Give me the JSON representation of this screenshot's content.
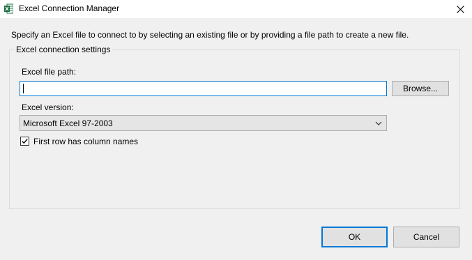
{
  "window": {
    "title": "Excel Connection Manager",
    "app_icon": "excel-icon",
    "close_icon": "close-icon"
  },
  "instruction": "Specify an Excel file to connect to by selecting an existing file or by providing a file path to create a new file.",
  "settings_group": {
    "legend": "Excel connection settings",
    "file_path_label": "Excel file path:",
    "file_path_value": "",
    "browse_label": "Browse...",
    "version_label": "Excel version:",
    "version_selected": "Microsoft Excel 97-2003",
    "first_row_label": "First row has column names",
    "first_row_checked": true
  },
  "buttons": {
    "ok_label": "OK",
    "cancel_label": "Cancel"
  },
  "colors": {
    "accent": "#0078d7",
    "dialog_background": "#f0f0f0",
    "excel_green": "#1d6f42"
  }
}
